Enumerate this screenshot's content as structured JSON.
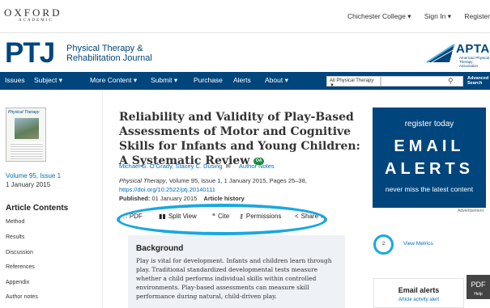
{
  "header": {
    "oxford": "OXFORD",
    "academic": "ACADEMIC",
    "institution": "Chichester College ▾",
    "sign_in": "Sign In ▾",
    "register": "Register"
  },
  "journal": {
    "logo": "PTJ",
    "name_line1": "Physical Therapy &",
    "name_line2": "Rehabilitation Journal",
    "apta_word": "APTA",
    "apta_sub": "American Physical Therapy Association"
  },
  "nav": {
    "items": [
      "Issues",
      "Subject ▾",
      "More Content ▾",
      "Submit ▾",
      "Purchase",
      "Alerts",
      "About ▾"
    ],
    "search_scope": "All Physical Therapy",
    "search_placeholder": "",
    "advanced_search": "Advanced Search"
  },
  "sidebar": {
    "cover_title": "Physical Therapy",
    "volume_link": "Volume 95, Issue 1",
    "volume_date": "1 January 2015",
    "contents_heading": "Article Contents",
    "contents": [
      "Method",
      "Results",
      "Discussion",
      "References",
      "Appendix",
      "Author notes"
    ]
  },
  "article": {
    "title": "Reliability and Validity of Play-Based Assessments of Motor and Cognitive Skills for Infants and Young Children: A Systematic Review",
    "open_access_badge": "OA",
    "authors": "Michael G. O’Grady, Stacey C. Dusing",
    "author_notes": "Author Notes",
    "citation_journal": "Physical Therapy",
    "citation_rest": ", Volume 95, Issue 1, 1 January 2015, Pages 25–38,",
    "doi": "https://doi.org/10.2522/ptj.20140111",
    "published_label": "Published:",
    "published_date": "01 January 2015",
    "history": "Article history"
  },
  "toolbar": {
    "pdf": "PDF",
    "split_view": "Split View",
    "cite": "Cite",
    "permissions": "Permissions",
    "share": "Share ▾"
  },
  "abstract": {
    "heading": "Background",
    "text": "Play is vital for development. Infants and children learn through play. Traditional standardized developmental tests measure whether a child performs individual skills within controlled environments. Play-based assessments can measure skill performance during natural, child-driven play."
  },
  "right": {
    "ad_line1": "register today",
    "ad_line2": "EMAIL",
    "ad_line3": "ALERTS",
    "ad_line4": "never miss the latest content",
    "advertisement": "Advertisement",
    "metrics_count": "2",
    "metrics_link": "View Metrics",
    "pdf_button": "PDF",
    "help": "Help",
    "email_alerts_heading": "Email alerts",
    "email_alerts_link": "Article activity alert"
  },
  "colors": {
    "brand_navy": "#00457c",
    "link_blue": "#006fb7",
    "highlight_ellipse": "#18a8e0",
    "open_access_green": "#1d8a3e"
  }
}
